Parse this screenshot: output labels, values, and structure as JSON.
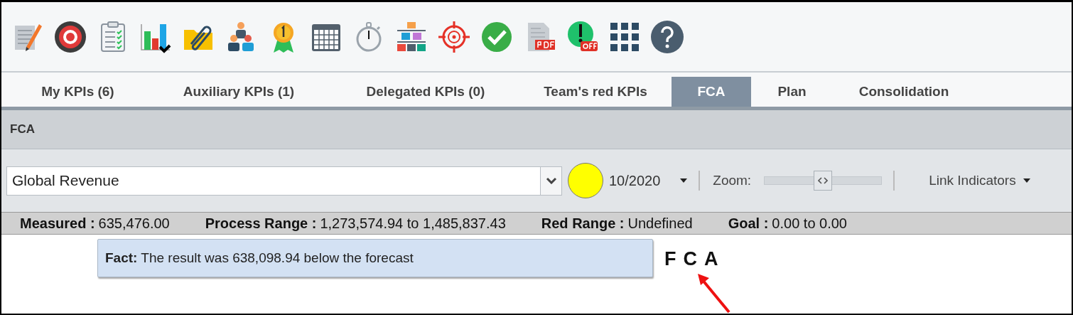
{
  "tabs": [
    {
      "label": "My KPIs (6)",
      "selected": false
    },
    {
      "label": "Auxiliary KPIs (1)",
      "selected": false
    },
    {
      "label": "Delegated KPIs (0)",
      "selected": false
    },
    {
      "label": "Team's red KPIs",
      "selected": false
    },
    {
      "label": "FCA",
      "selected": true
    },
    {
      "label": "Plan",
      "selected": false
    },
    {
      "label": "Consolidation",
      "selected": false
    }
  ],
  "panel": {
    "title": "FCA"
  },
  "controls": {
    "indicator_select": "Global Revenue",
    "status": {
      "color": "#ffff00"
    },
    "period": "10/2020",
    "zoom_label": "Zoom:",
    "zoom": {
      "level": 0.5
    },
    "link_menu": "Link Indicators"
  },
  "stats": [
    {
      "label": "Measured :",
      "value": "635,476.00"
    },
    {
      "label": "Process Range :",
      "value": "1,273,574.94 to 1,485,837.43"
    },
    {
      "label": "Red Range :",
      "value": "Undefined"
    },
    {
      "label": "Goal :",
      "value": "0.00 to 0.00"
    }
  ],
  "fact": "**Fact:** The result was 638,098.94 below the forecast",
  "fca_letters": [
    "F",
    "C",
    "A"
  ]
}
